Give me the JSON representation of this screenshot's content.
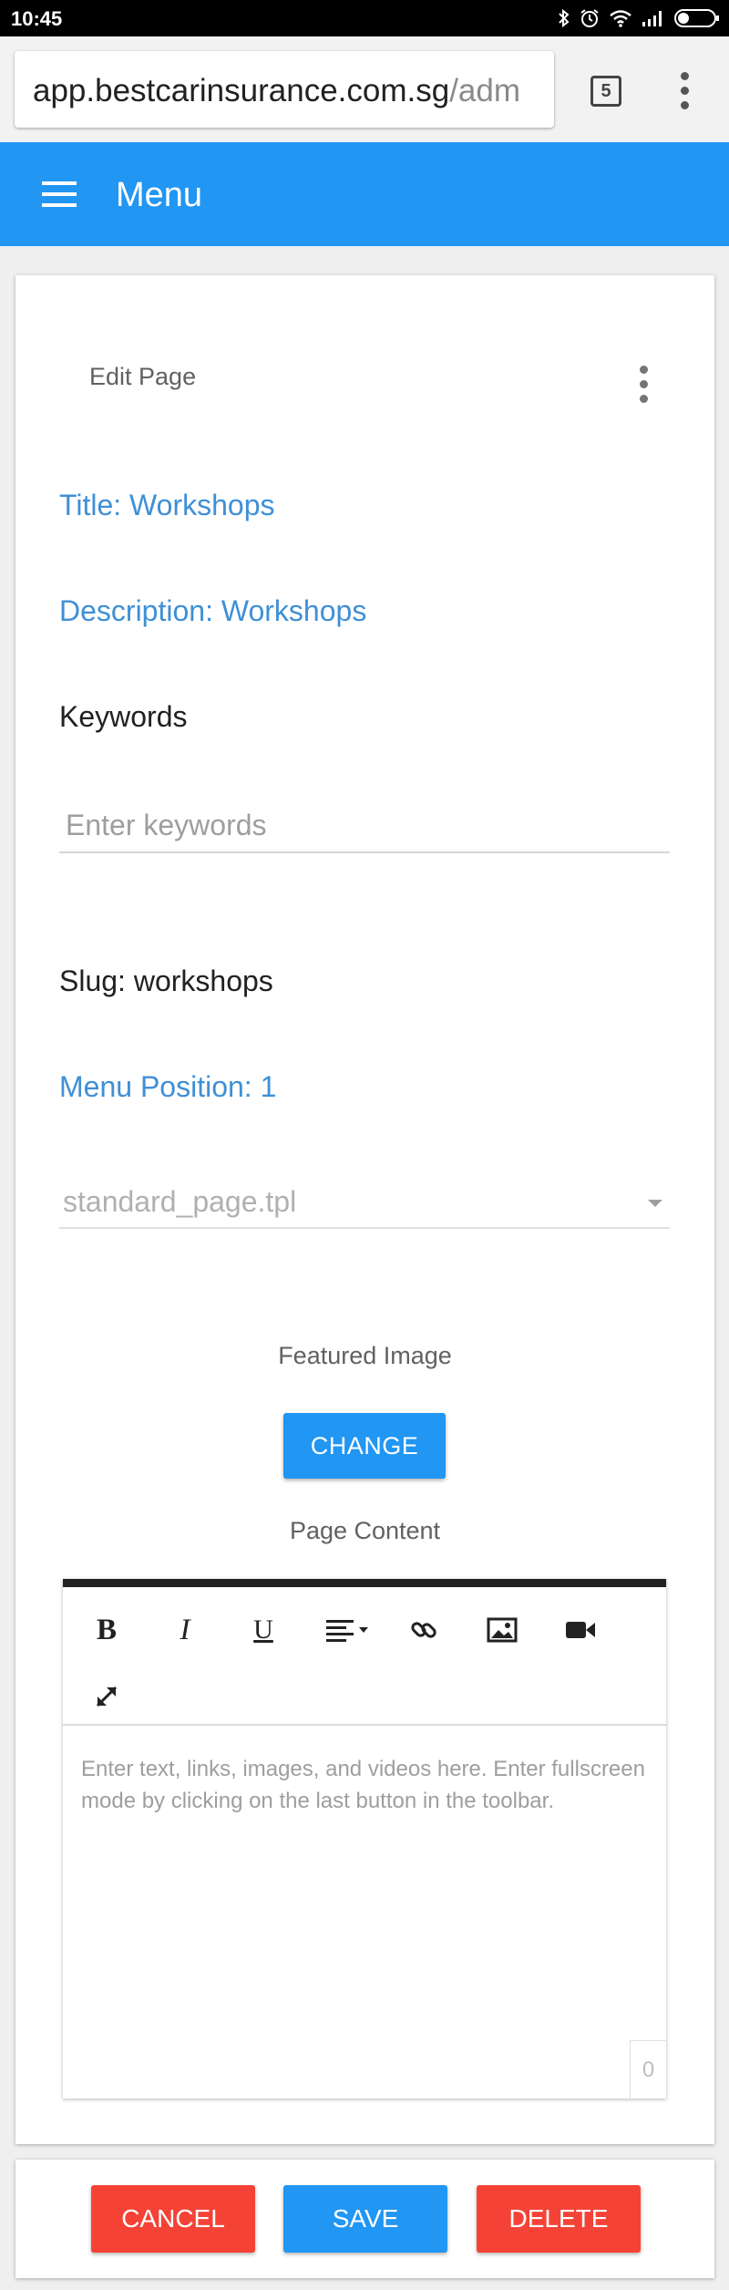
{
  "status_bar": {
    "time": "10:45",
    "icons": [
      "bluetooth-icon",
      "alarm-icon",
      "wifi-icon",
      "signal-icon",
      "battery-icon"
    ]
  },
  "browser": {
    "url_domain": "app.bestcarinsurance.com.sg",
    "url_path": "/adm",
    "tab_count": "5"
  },
  "header": {
    "title": "Menu"
  },
  "card": {
    "title": "Edit Page",
    "title_field": "Title: Workshops",
    "description_field": "Description: Workshops",
    "keywords_label": "Keywords",
    "keywords_placeholder": "Enter keywords",
    "keywords_value": "",
    "slug": "Slug: workshops",
    "menu_position": "Menu Position: 1",
    "template_value": "standard_page.tpl",
    "featured_image_label": "Featured Image",
    "change_button": "CHANGE",
    "page_content_label": "Page Content"
  },
  "editor": {
    "toolbar": [
      "bold",
      "italic",
      "underline",
      "align",
      "link",
      "image",
      "video",
      "fullscreen"
    ],
    "placeholder": "Enter text, links, images, and videos here. Enter fullscreen mode by clicking on the last button in the toolbar.",
    "char_count": "0"
  },
  "actions": {
    "cancel": "CANCEL",
    "save": "SAVE",
    "delete": "DELETE"
  },
  "colors": {
    "primary": "#2196f3",
    "danger": "#f44336",
    "field_blue": "#3f8fd6"
  }
}
